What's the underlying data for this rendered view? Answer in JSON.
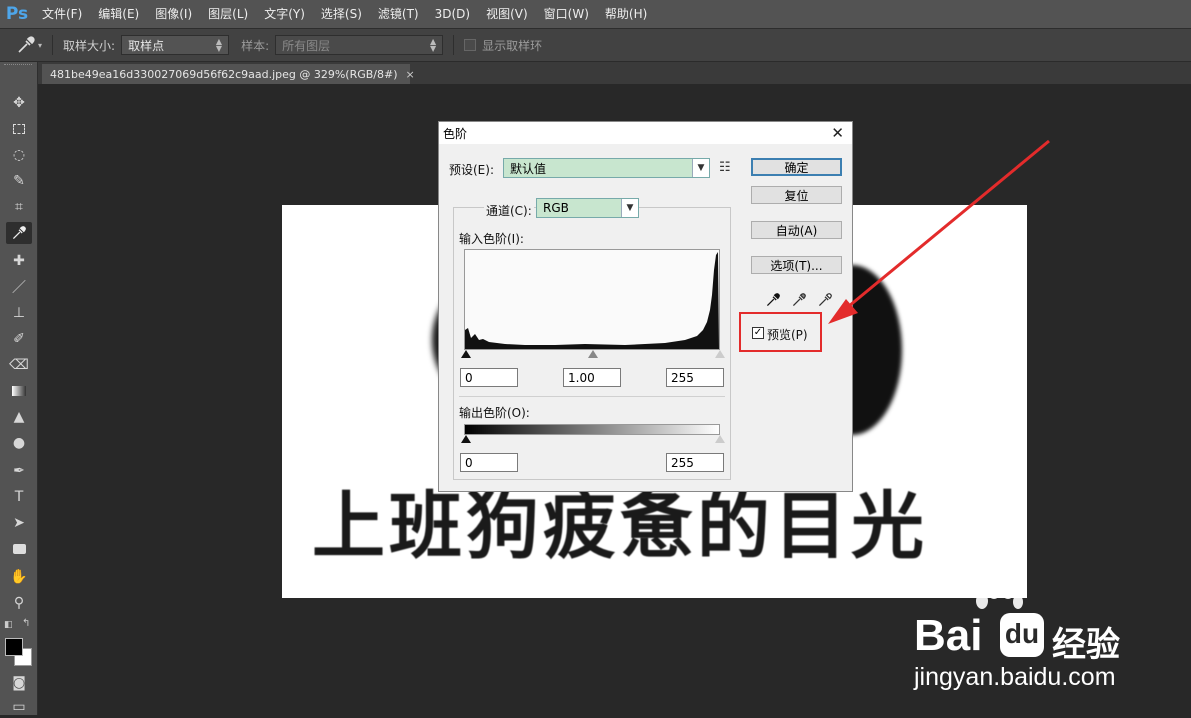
{
  "menubar": {
    "logo": "Ps",
    "items": [
      "文件(F)",
      "编辑(E)",
      "图像(I)",
      "图层(L)",
      "文字(Y)",
      "选择(S)",
      "滤镜(T)",
      "3D(D)",
      "视图(V)",
      "窗口(W)",
      "帮助(H)"
    ]
  },
  "options": {
    "sample_size_label": "取样大小:",
    "sample_size_value": "取样点",
    "sample_label": "样本:",
    "sample_value": "所有图层",
    "show_ring_label": "显示取样环"
  },
  "document_tab": {
    "title": "481be49ea16d330027069d56f62c9aad.jpeg @ 329%(RGB/8#)",
    "close": "×"
  },
  "document": {
    "text": "上班狗疲惫的目光"
  },
  "levels_dialog": {
    "title": "色阶",
    "close": "✕",
    "preset_label": "预设(E):",
    "preset_value": "默认值",
    "channel_label": "通道(C):",
    "channel_value": "RGB",
    "input_levels_label": "输入色阶(I):",
    "input_black": "0",
    "input_gamma": "1.00",
    "input_white": "255",
    "output_levels_label": "输出色阶(O):",
    "output_black": "0",
    "output_white": "255",
    "buttons": {
      "ok": "确定",
      "reset": "复位",
      "auto": "自动(A)",
      "options": "选项(T)..."
    },
    "preview_label": "预览(P)",
    "preview_checked": true
  },
  "watermark": {
    "brand": "Bai",
    "suffix": "经验",
    "url": "jingyan.baidu.com"
  },
  "annotation": {
    "color": "#e32b2b"
  }
}
